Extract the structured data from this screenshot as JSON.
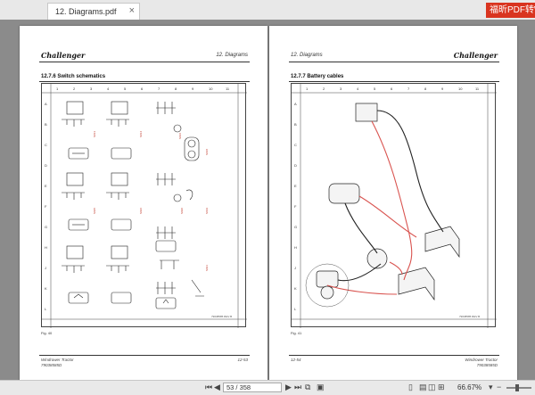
{
  "tab": {
    "title": "12. Diagrams.pdf",
    "close": "×"
  },
  "watermark": "福昕PDF转W",
  "left_page": {
    "logo": "Challenger",
    "chapter": "12. Diagrams",
    "section": "12.7.6  Switch schematics",
    "figure": "Fig. 40",
    "footer_left_1": "Windrower Tractor",
    "footer_left_2": "79038585D",
    "footer_right": "12-53",
    "col_numbers": [
      "1",
      "2",
      "3",
      "4",
      "5",
      "6",
      "7",
      "8",
      "9",
      "10",
      "11"
    ],
    "row_letters": [
      "A",
      "B",
      "C",
      "D",
      "E",
      "F",
      "G",
      "H",
      "J",
      "K",
      "L"
    ]
  },
  "right_page": {
    "logo": "Challenger",
    "chapter": "12. Diagrams",
    "section": "12.7.7  Battery cables",
    "figure": "Fig. 41",
    "footer_left": "12-54",
    "footer_right_1": "Windrower Tractor",
    "footer_right_2": "79038585D",
    "col_numbers": [
      "1",
      "2",
      "3",
      "4",
      "5",
      "6",
      "7",
      "8",
      "9",
      "10",
      "11"
    ],
    "row_letters": [
      "A",
      "B",
      "C",
      "D",
      "E",
      "F",
      "G",
      "H",
      "J",
      "K",
      "L"
    ]
  },
  "status": {
    "page_value": "53 / 358",
    "zoom": "66.67%"
  },
  "colors": {
    "accent_red": "#d9341f",
    "wire_red": "#d9534f"
  }
}
